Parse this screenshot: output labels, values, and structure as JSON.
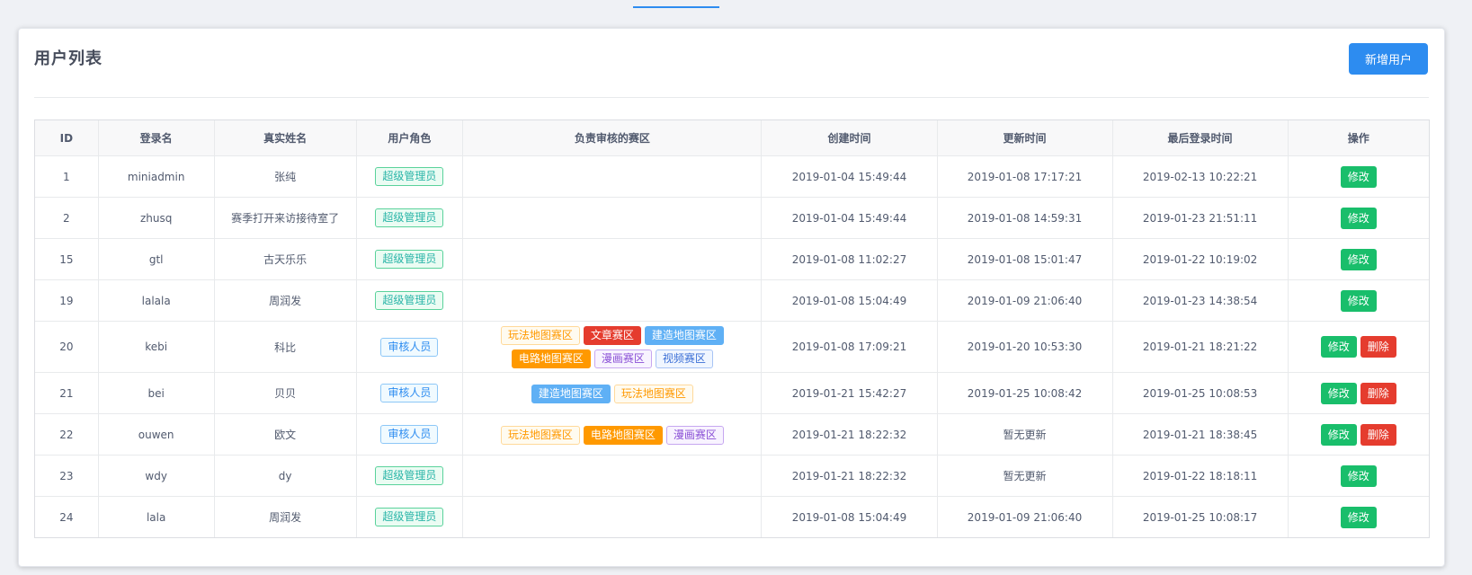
{
  "page": {
    "title": "用户列表",
    "add_button": "新增用户"
  },
  "colors": {
    "primary": "#2d8cf0",
    "success": "#19be6b",
    "danger": "#e53c2e",
    "warning": "#ff9900"
  },
  "table": {
    "headers": [
      "ID",
      "登录名",
      "真实姓名",
      "用户角色",
      "负责审核的赛区",
      "创建时间",
      "更新时间",
      "最后登录时间",
      "操作"
    ],
    "actions": {
      "edit": "修改",
      "delete": "删除"
    },
    "rows": [
      {
        "id": "1",
        "login": "miniadmin",
        "name": "张纯",
        "role": "超级管理员",
        "zones": [],
        "created": "2019-01-04 15:49:44",
        "updated": "2019-01-08 17:17:21",
        "last_login": "2019-02-13 10:22:21"
      },
      {
        "id": "2",
        "login": "zhusq",
        "name": "赛季打开来访接待室了",
        "role": "超级管理员",
        "zones": [],
        "created": "2019-01-04 15:49:44",
        "updated": "2019-01-08 14:59:31",
        "last_login": "2019-01-23 21:51:11"
      },
      {
        "id": "15",
        "login": "gtl",
        "name": "古天乐乐",
        "role": "超级管理员",
        "zones": [],
        "created": "2019-01-08 11:02:27",
        "updated": "2019-01-08 15:01:47",
        "last_login": "2019-01-22 10:19:02"
      },
      {
        "id": "19",
        "login": "lalala",
        "name": "周润发",
        "role": "超级管理员",
        "zones": [],
        "created": "2019-01-08 15:04:49",
        "updated": "2019-01-09 21:06:40",
        "last_login": "2019-01-23 14:38:54"
      },
      {
        "id": "20",
        "login": "kebi",
        "name": "科比",
        "role": "审核人员",
        "zones": [
          "玩法地图赛区",
          "文章赛区",
          "建造地图赛区",
          "电路地图赛区",
          "漫画赛区",
          "视频赛区"
        ],
        "created": "2019-01-08 17:09:21",
        "updated": "2019-01-20 10:53:30",
        "last_login": "2019-01-21 18:21:22"
      },
      {
        "id": "21",
        "login": "bei",
        "name": "贝贝",
        "role": "审核人员",
        "zones": [
          "建造地图赛区",
          "玩法地图赛区"
        ],
        "created": "2019-01-21 15:42:27",
        "updated": "2019-01-25 10:08:42",
        "last_login": "2019-01-25 10:08:53"
      },
      {
        "id": "22",
        "login": "ouwen",
        "name": "欧文",
        "role": "审核人员",
        "zones": [
          "玩法地图赛区",
          "电路地图赛区",
          "漫画赛区"
        ],
        "created": "2019-01-21 18:22:32",
        "updated": "暂无更新",
        "last_login": "2019-01-21 18:38:45"
      },
      {
        "id": "23",
        "login": "wdy",
        "name": "dy",
        "role": "超级管理员",
        "zones": [],
        "created": "2019-01-21 18:22:32",
        "updated": "暂无更新",
        "last_login": "2019-01-22 18:18:11"
      },
      {
        "id": "24",
        "login": "lala",
        "name": "周润发",
        "role": "超级管理员",
        "zones": [],
        "created": "2019-01-08 15:04:49",
        "updated": "2019-01-09 21:06:40",
        "last_login": "2019-01-25 10:08:17"
      }
    ]
  }
}
